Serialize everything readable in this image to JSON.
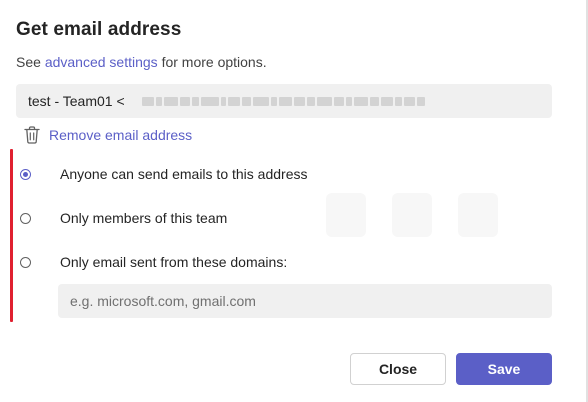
{
  "dialog": {
    "title": "Get email address",
    "subtitle_prefix": "See",
    "subtitle_link": "advanced settings",
    "subtitle_suffix": "for more options.",
    "email_value": "test - Team01 <",
    "remove_label": "Remove email address",
    "accent_color": "#5b5fc7",
    "validation_bar_color": "#e02030"
  },
  "options": [
    {
      "label": "Anyone can send emails to this address",
      "selected": true
    },
    {
      "label": "Only members of this team",
      "selected": false
    },
    {
      "label": "Only email sent from these domains:",
      "selected": false
    }
  ],
  "domains": {
    "placeholder": "e.g. microsoft.com, gmail.com",
    "value": ""
  },
  "footer": {
    "close_label": "Close",
    "save_label": "Save"
  },
  "icons": {
    "remove": "trash-icon"
  }
}
